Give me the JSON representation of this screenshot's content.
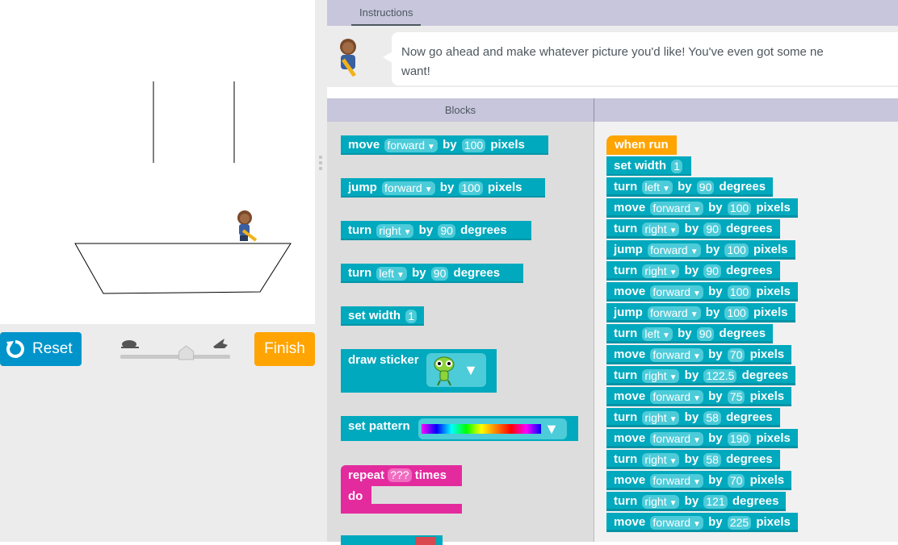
{
  "instructions": {
    "tab_label": "Instructions",
    "text_line1": "Now go ahead and make whatever picture you'd like! You've even got some ne",
    "text_line2": "want!"
  },
  "controls": {
    "reset_label": "Reset",
    "finish_label": "Finish",
    "speed_value": 0.6
  },
  "blocks_header": {
    "title": "Blocks"
  },
  "toolbox": {
    "move": {
      "verb": "move",
      "dir": "forward",
      "by": "by",
      "amount": "100",
      "unit": "pixels"
    },
    "jump": {
      "verb": "jump",
      "dir": "forward",
      "by": "by",
      "amount": "100",
      "unit": "pixels"
    },
    "turn_right": {
      "verb": "turn",
      "dir": "right",
      "by": "by",
      "amount": "90",
      "unit": "degrees"
    },
    "turn_left": {
      "verb": "turn",
      "dir": "left",
      "by": "by",
      "amount": "90",
      "unit": "degrees"
    },
    "set_width": {
      "label": "set width",
      "value": "1"
    },
    "draw_sticker": {
      "label": "draw sticker"
    },
    "set_pattern": {
      "label": "set pattern"
    },
    "repeat": {
      "label_before": "repeat",
      "value": "???",
      "label_after": "times",
      "do": "do"
    }
  },
  "workspace": {
    "when_run": "when run",
    "set_width": {
      "label": "set width",
      "value": "1"
    },
    "program": [
      {
        "verb": "turn",
        "dir": "left",
        "amount": "90",
        "unit": "degrees"
      },
      {
        "verb": "move",
        "dir": "forward",
        "amount": "100",
        "unit": "pixels"
      },
      {
        "verb": "turn",
        "dir": "right",
        "amount": "90",
        "unit": "degrees"
      },
      {
        "verb": "jump",
        "dir": "forward",
        "amount": "100",
        "unit": "pixels"
      },
      {
        "verb": "turn",
        "dir": "right",
        "amount": "90",
        "unit": "degrees"
      },
      {
        "verb": "move",
        "dir": "forward",
        "amount": "100",
        "unit": "pixels"
      },
      {
        "verb": "jump",
        "dir": "forward",
        "amount": "100",
        "unit": "pixels"
      },
      {
        "verb": "turn",
        "dir": "left",
        "amount": "90",
        "unit": "degrees"
      },
      {
        "verb": "move",
        "dir": "forward",
        "amount": "70",
        "unit": "pixels"
      },
      {
        "verb": "turn",
        "dir": "right",
        "amount": "122.5",
        "unit": "degrees"
      },
      {
        "verb": "move",
        "dir": "forward",
        "amount": "75",
        "unit": "pixels"
      },
      {
        "verb": "turn",
        "dir": "right",
        "amount": "58",
        "unit": "degrees"
      },
      {
        "verb": "move",
        "dir": "forward",
        "amount": "190",
        "unit": "pixels"
      },
      {
        "verb": "turn",
        "dir": "right",
        "amount": "58",
        "unit": "degrees"
      },
      {
        "verb": "move",
        "dir": "forward",
        "amount": "70",
        "unit": "pixels"
      },
      {
        "verb": "turn",
        "dir": "right",
        "amount": "121",
        "unit": "degrees"
      },
      {
        "verb": "move",
        "dir": "forward",
        "amount": "225",
        "unit": "pixels"
      }
    ],
    "by_word": "by"
  },
  "colors": {
    "motion_block": "#00a9bd",
    "event_block": "#ffa400",
    "loop_block": "#e32b9e",
    "reset_button": "#0094ca",
    "finish_button": "#ffa400",
    "header": "#c7c6dc"
  }
}
